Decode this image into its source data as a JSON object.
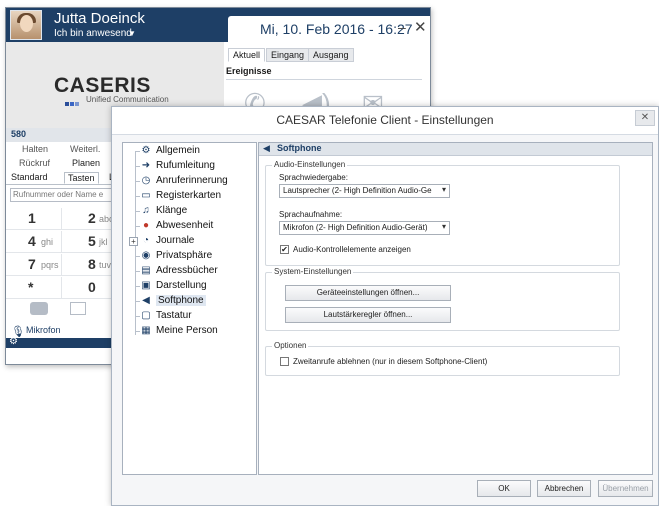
{
  "client": {
    "user_name": "Jutta Doeinck",
    "user_status": "Ich bin anwesend",
    "datetime": "Mi, 10. Feb 2016 - 16:27",
    "logo_word": "CASERIS",
    "logo_sub": "Unified Communication",
    "extension": "580",
    "event_tabs": [
      "Aktuell",
      "Eingang",
      "Ausgang"
    ],
    "events_title": "Ereignisse",
    "call_buttons_row1": [
      "Halten",
      "Weiterl."
    ],
    "call_buttons_row2": [
      "Rückruf",
      "Planen"
    ],
    "tabs": [
      "Standard",
      "Tasten",
      "L"
    ],
    "dial_placeholder": "Rufnummer oder Name e",
    "keys": [
      {
        "digit": "1",
        "letters": ""
      },
      {
        "digit": "2",
        "letters": "abc"
      },
      {
        "digit": "4",
        "letters": "ghi"
      },
      {
        "digit": "5",
        "letters": "jkl"
      },
      {
        "digit": "7",
        "letters": "pqrs"
      },
      {
        "digit": "8",
        "letters": "tuv"
      },
      {
        "digit": "*",
        "letters": ""
      },
      {
        "digit": "0",
        "letters": ""
      }
    ],
    "mic_label": "Mikrofon"
  },
  "settings": {
    "title": "CAESAR Telefonie Client - Einstellungen",
    "nav": [
      {
        "label": "Allgemein",
        "icon": "gear-icon"
      },
      {
        "label": "Rufumleitung",
        "icon": "forward-arrow-icon"
      },
      {
        "label": "Anruferinnerung",
        "icon": "clock-icon"
      },
      {
        "label": "Registerkarten",
        "icon": "folder-icon"
      },
      {
        "label": "Klänge",
        "icon": "music-note-icon"
      },
      {
        "label": "Abwesenheit",
        "icon": "person-away-icon"
      },
      {
        "label": "Journale",
        "icon": "journal-clock-icon"
      },
      {
        "label": "Privatsphäre",
        "icon": "eye-icon"
      },
      {
        "label": "Adressbücher",
        "icon": "address-book-icon"
      },
      {
        "label": "Darstellung",
        "icon": "display-icon"
      },
      {
        "label": "Softphone",
        "icon": "mic-speaker-icon"
      },
      {
        "label": "Tastatur",
        "icon": "keyboard-key-icon"
      },
      {
        "label": "Meine Person",
        "icon": "person-card-icon"
      }
    ],
    "section_title": "Softphone",
    "audio": {
      "group_title": "Audio-Einstellungen",
      "playback_label": "Sprachwiedergabe:",
      "playback_value": "Lautsprecher (2- High Definition Audio-Ge",
      "record_label": "Sprachaufnahme:",
      "record_value": "Mikrofon (2- High Definition Audio-Gerät)",
      "show_controls_label": "Audio-Kontrollelemente anzeigen",
      "show_controls_checked": true
    },
    "system": {
      "group_title": "System-Einstellungen",
      "device_btn": "Geräteeinstellungen öffnen...",
      "volume_btn": "Lautstärkeregler öffnen..."
    },
    "options": {
      "group_title": "Optionen",
      "reject_label": "Zweitanrufe ablehnen (nur in diesem Softphone-Client)",
      "reject_checked": false
    },
    "buttons": {
      "ok": "OK",
      "cancel": "Abbrechen",
      "apply": "Übernehmen"
    }
  }
}
